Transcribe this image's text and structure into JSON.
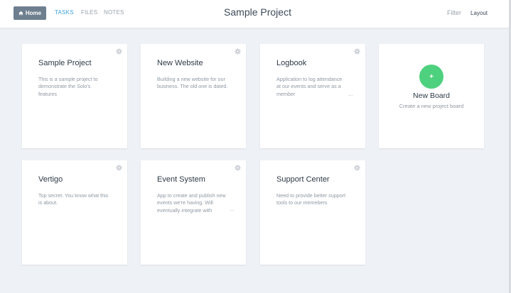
{
  "nav": {
    "home_label": "Home",
    "tasks_label": "TASKS",
    "files_label": "FILES",
    "notes_label": "NOTES",
    "project_title": "Sample Project",
    "filter_label": "Filter",
    "layout_label": "Layout"
  },
  "colors": {
    "accent": "#3aa0d8",
    "home_button": "#6e7f8f",
    "new_board": "#4ed17e",
    "background": "#eef1f5"
  },
  "boards": [
    {
      "title": "Sample Project",
      "description": "This is a sample project to demonstrate the Solo's features"
    },
    {
      "title": "New Website",
      "description": "Building a new website for our business. The old one is dated."
    },
    {
      "title": "Logbook",
      "description": "Application to log attendance at our events and serve as a member",
      "overflow": "…"
    },
    {
      "title": "Vertigo",
      "description": "Top secret. You know what this is about."
    },
    {
      "title": "Event System",
      "description": "App to create and publish new events we're having. Will eventually integrate with",
      "overflow": "…"
    },
    {
      "title": "Support Center",
      "description": "Need to provide better support tools to our memebers"
    }
  ],
  "new_board": {
    "icon": "plus-icon",
    "plus_glyph": "+",
    "title": "New Board",
    "subtitle": "Create a new project board"
  },
  "icons": {
    "home": "home-icon",
    "settings": "gear-icon"
  }
}
